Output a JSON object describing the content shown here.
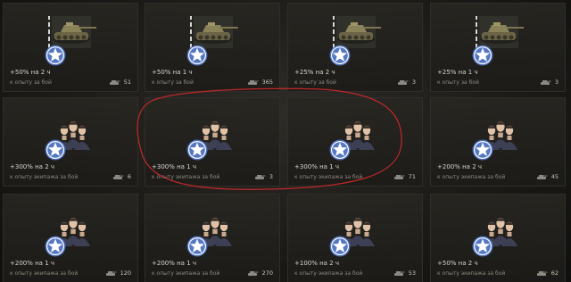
{
  "cards": [
    {
      "type": "tank",
      "title": "+50% на 2 ч",
      "subtitle": "к опыту за бой",
      "count": "51"
    },
    {
      "type": "tank",
      "title": "+50% на 1 ч",
      "subtitle": "к опыту за бой",
      "count": "365"
    },
    {
      "type": "tank",
      "title": "+25% на 2 ч",
      "subtitle": "к опыту за бой",
      "count": "3"
    },
    {
      "type": "tank",
      "title": "+25% на 1 ч",
      "subtitle": "к опыту за бой",
      "count": "3"
    },
    {
      "type": "crew",
      "title": "+300% на 2 ч",
      "subtitle": "к опыту экипажа за бой",
      "count": "6"
    },
    {
      "type": "crew",
      "title": "+300% на 1 ч",
      "subtitle": "к опыту экипажа за бой",
      "count": "3"
    },
    {
      "type": "crew",
      "title": "+300% на 1 ч",
      "subtitle": "к опыту экипажа за бой",
      "count": "71"
    },
    {
      "type": "crew",
      "title": "+200% на 2 ч",
      "subtitle": "к опыту экипажа за бой",
      "count": "45"
    },
    {
      "type": "crew",
      "title": "+200% на 1 ч",
      "subtitle": "к опыту экипажа за бой",
      "count": "120"
    },
    {
      "type": "crew",
      "title": "+200% на 1 ч",
      "subtitle": "к опыту экипажа за бой",
      "count": "270"
    },
    {
      "type": "crew",
      "title": "+100% на 2 ч",
      "subtitle": "к опыту экипажа за бой",
      "count": "53"
    },
    {
      "type": "crew",
      "title": "+50% на 2 ч",
      "subtitle": "к опыту экипажа за бой",
      "count": "62"
    }
  ],
  "icons": {
    "tank_art": "tank-icon",
    "crew_art": "crew-icon",
    "star": "star-icon",
    "count": "tank-silhouette-icon"
  },
  "colors": {
    "annotation": "#c0282a",
    "star_blue": "#4a6db8",
    "star_white": "#ffffff"
  }
}
